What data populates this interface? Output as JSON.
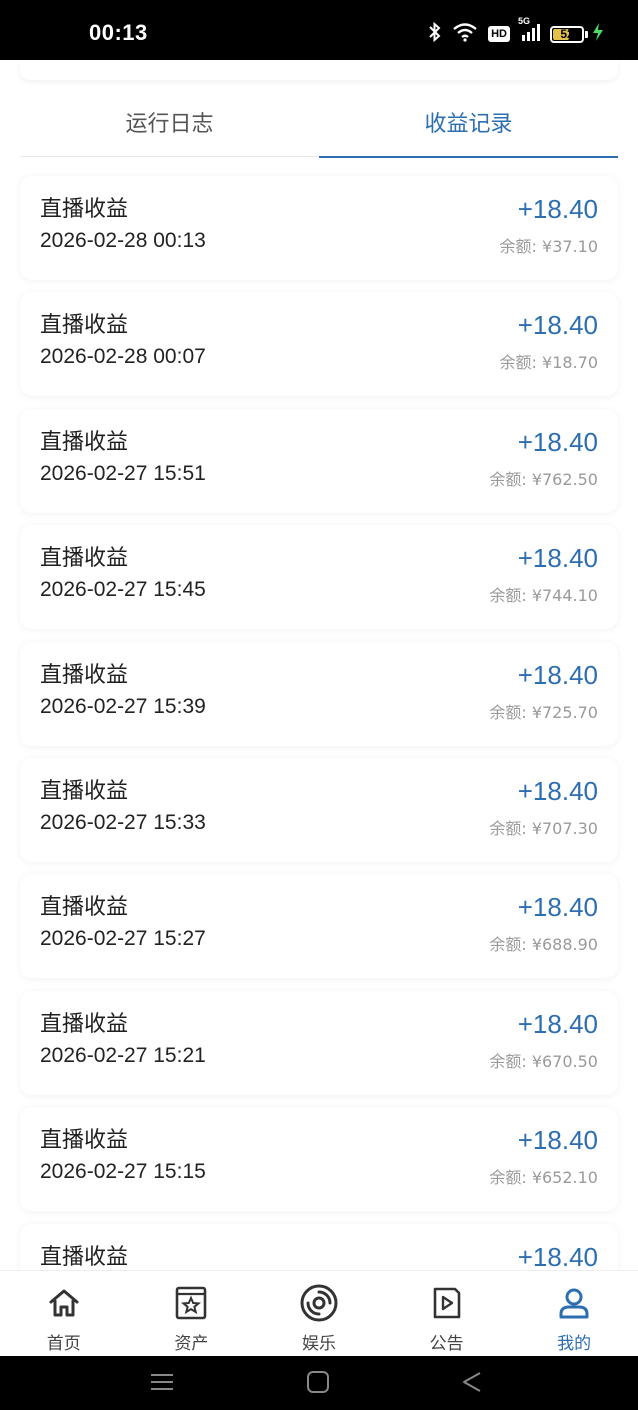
{
  "status_bar": {
    "time": "00:13",
    "network": "5G",
    "hd": "HD",
    "battery": "52",
    "battery_level": 0.52
  },
  "tabs": [
    {
      "label": "运行日志",
      "active": false
    },
    {
      "label": "收益记录",
      "active": true
    }
  ],
  "records": [
    {
      "title": "直播收益",
      "time": "2026-02-28 00:13",
      "amount": "+18.40",
      "balance": "余额: ¥37.10"
    },
    {
      "title": "直播收益",
      "time": "2026-02-28 00:07",
      "amount": "+18.40",
      "balance": "余额: ¥18.70"
    },
    {
      "title": "直播收益",
      "time": "2026-02-27 15:51",
      "amount": "+18.40",
      "balance": "余额: ¥762.50"
    },
    {
      "title": "直播收益",
      "time": "2026-02-27 15:45",
      "amount": "+18.40",
      "balance": "余额: ¥744.10"
    },
    {
      "title": "直播收益",
      "time": "2026-02-27 15:39",
      "amount": "+18.40",
      "balance": "余额: ¥725.70"
    },
    {
      "title": "直播收益",
      "time": "2026-02-27 15:33",
      "amount": "+18.40",
      "balance": "余额: ¥707.30"
    },
    {
      "title": "直播收益",
      "time": "2026-02-27 15:27",
      "amount": "+18.40",
      "balance": "余额: ¥688.90"
    },
    {
      "title": "直播收益",
      "time": "2026-02-27 15:21",
      "amount": "+18.40",
      "balance": "余额: ¥670.50"
    },
    {
      "title": "直播收益",
      "time": "2026-02-27 15:15",
      "amount": "+18.40",
      "balance": "余额: ¥652.10"
    },
    {
      "title": "直播收益",
      "time": "",
      "amount": "+18.40",
      "balance": ""
    }
  ],
  "bottom_nav": [
    {
      "label": "首页",
      "icon": "home-icon",
      "active": false
    },
    {
      "label": "资产",
      "icon": "assets-icon",
      "active": false
    },
    {
      "label": "娱乐",
      "icon": "entertainment-icon",
      "active": false
    },
    {
      "label": "公告",
      "icon": "announcement-icon",
      "active": false
    },
    {
      "label": "我的",
      "icon": "profile-icon",
      "active": true
    }
  ],
  "colors": {
    "accent": "#2d6eb0",
    "balance_text": "#9a9a9a",
    "battery_fill": "#e2c24a",
    "charging": "#4cd964"
  }
}
